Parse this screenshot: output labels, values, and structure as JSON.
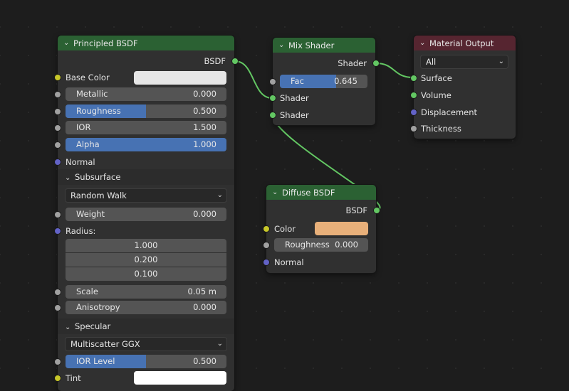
{
  "principled": {
    "title": "Principled BSDF",
    "output_label": "BSDF",
    "base_color_label": "Base Color",
    "base_color_value": "#e6e6e6",
    "metallic": {
      "label": "Metallic",
      "value": "0.000",
      "fill": 0
    },
    "roughness": {
      "label": "Roughness",
      "value": "0.500",
      "fill": 0.5
    },
    "ior": {
      "label": "IOR",
      "value": "1.500",
      "fill": 0
    },
    "alpha": {
      "label": "Alpha",
      "value": "1.000",
      "fill": 1.0
    },
    "normal_label": "Normal",
    "subsurface": {
      "title": "Subsurface",
      "method": "Random Walk",
      "weight": {
        "label": "Weight",
        "value": "0.000"
      },
      "radius_label": "Radius:",
      "radius_values": [
        "1.000",
        "0.200",
        "0.100"
      ],
      "scale": {
        "label": "Scale",
        "value": "0.05 m"
      },
      "anisotropy": {
        "label": "Anisotropy",
        "value": "0.000"
      }
    },
    "specular": {
      "title": "Specular",
      "distribution": "Multiscatter GGX",
      "ior_level": {
        "label": "IOR Level",
        "value": "0.500",
        "fill": 0.5
      },
      "tint_label": "Tint",
      "tint_value": "#ffffff"
    }
  },
  "mix": {
    "title": "Mix Shader",
    "output_label": "Shader",
    "fac": {
      "label": "Fac",
      "value": "0.645",
      "fill": 0.645
    },
    "input1_label": "Shader",
    "input2_label": "Shader"
  },
  "diffuse": {
    "title": "Diffuse BSDF",
    "output_label": "BSDF",
    "color_label": "Color",
    "color_value": "#e8b07a",
    "roughness": {
      "label": "Roughness",
      "value": "0.000"
    },
    "normal_label": "Normal"
  },
  "output": {
    "title": "Material Output",
    "target": "All",
    "surface_label": "Surface",
    "volume_label": "Volume",
    "displacement_label": "Displacement",
    "thickness_label": "Thickness"
  },
  "colors": {
    "shader_header": "#2b6133",
    "output_header": "#562530",
    "link_green": "#63c763",
    "slider_fill": "#4772b3"
  }
}
